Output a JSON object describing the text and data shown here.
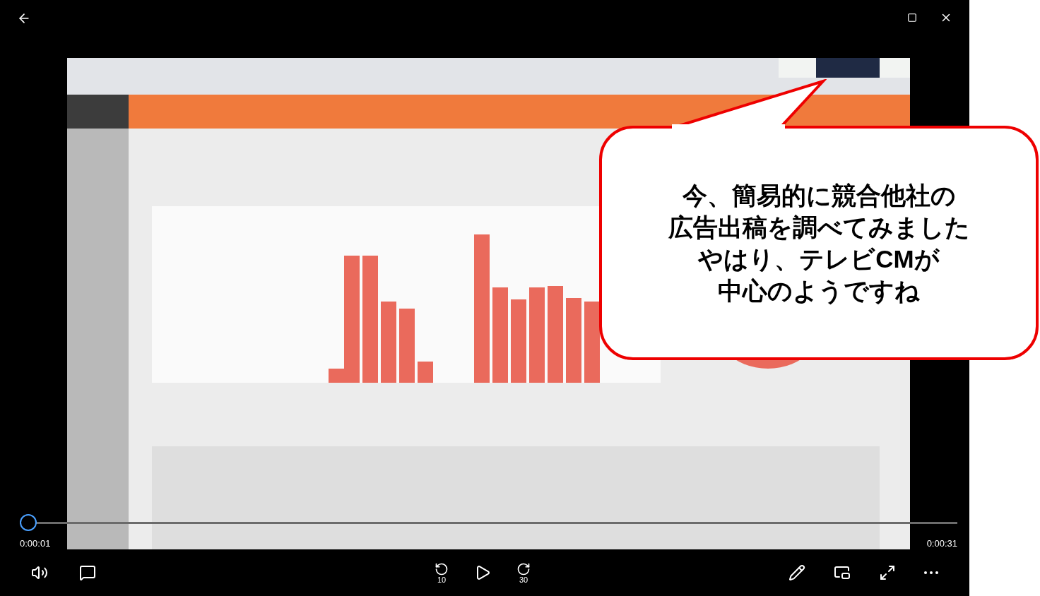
{
  "player": {
    "elapsed": "0:00:01",
    "total": "0:00:31",
    "progress": {
      "level": 0.0
    },
    "rewind_label": "10",
    "forward_label": "30",
    "playing": false
  },
  "callout": {
    "lines": [
      "今、簡易的に競合他社の",
      "広告出稿を調べてみました",
      "やはり、テレビCMが",
      "中心のようですね"
    ]
  }
}
